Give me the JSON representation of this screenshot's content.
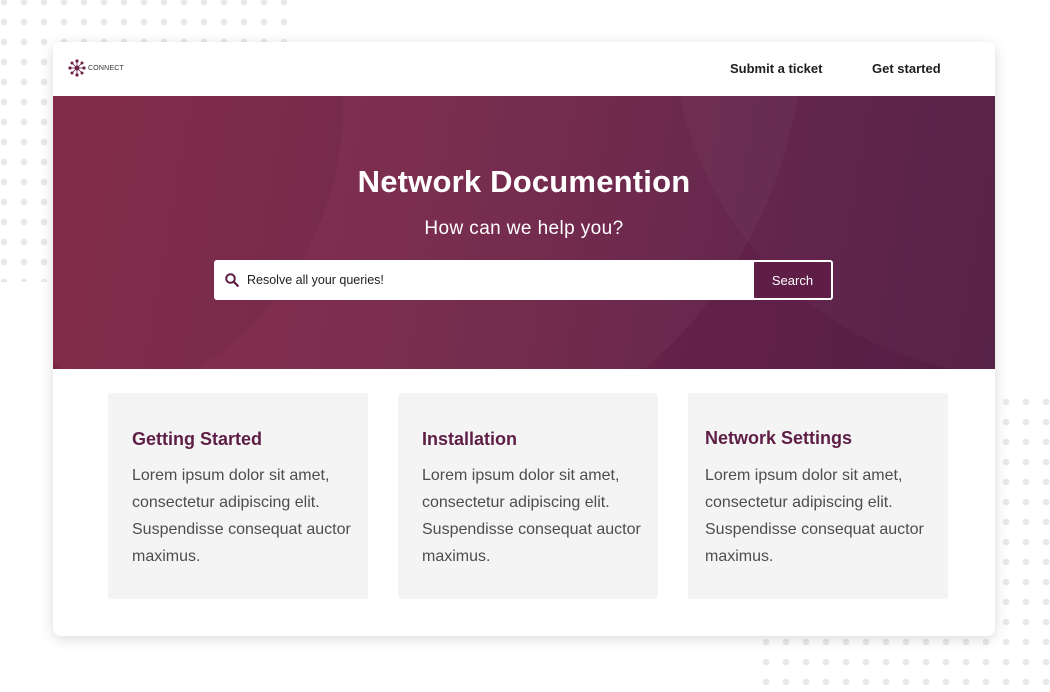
{
  "header": {
    "logo_text": "CONNECT",
    "nav": [
      {
        "label": "Submit a ticket"
      },
      {
        "label": "Get started"
      }
    ]
  },
  "hero": {
    "title": "Network Documention",
    "subtitle": "How can we help you?",
    "search": {
      "value": "Resolve all your queries!",
      "button_label": "Search"
    }
  },
  "cards": [
    {
      "title": "Getting Started",
      "text": "Lorem ipsum dolor sit amet, consectetur adipiscing elit. Suspendisse consequat auctor maximus."
    },
    {
      "title": "Installation",
      "text": "Lorem ipsum dolor sit amet, consectetur adipiscing elit. Suspendisse consequat auctor maximus."
    },
    {
      "title": "Network Settings",
      "text": "Lorem ipsum dolor sit amet, consectetur adipiscing elit. Suspendisse consequat auctor maximus."
    }
  ],
  "icons": {
    "logo": "network-flower-logo-icon",
    "search": "magnifier-icon"
  },
  "colors": {
    "brand": "#5e1e45",
    "hero_start": "#852847",
    "hero_end": "#541e44",
    "card_bg": "#f4f4f5",
    "body_text": "#4d4d4d"
  }
}
